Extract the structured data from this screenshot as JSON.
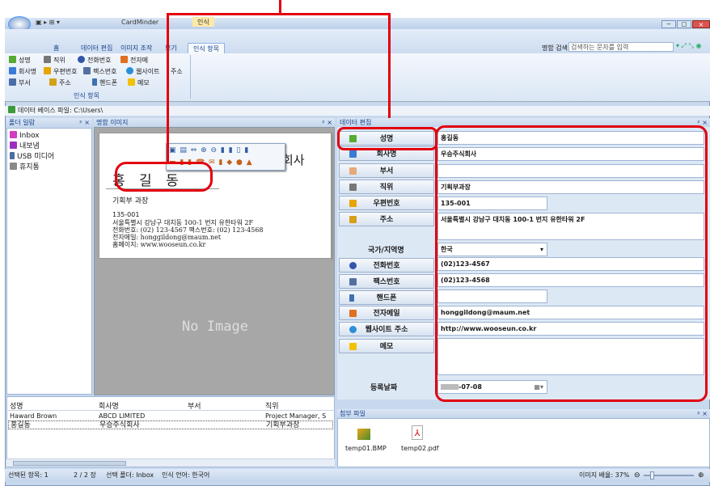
{
  "app": {
    "title": "CardMinder",
    "context_tab": "인식",
    "window_buttons": [
      "−",
      "□",
      "×"
    ]
  },
  "ribbon": {
    "tabs": [
      "홈",
      "데이터 편집",
      "이미지 조작",
      "보기",
      "인식 항목"
    ],
    "active_tab": "인식 항목",
    "search_label": "명함 검색:",
    "search_placeholder": "검색하는 문자를 입력",
    "items_row1": [
      "성명",
      "직위",
      "전화번호",
      "전자메"
    ],
    "items_row2": [
      "회사명",
      "우편번호",
      "팩스번호",
      "웹사이트",
      "주소"
    ],
    "items_row3": [
      "부서",
      "주소",
      "핸드폰",
      "메모"
    ],
    "group_label": "인식 항목"
  },
  "database_path": "데이터 베이스 파일: C:\\Users\\",
  "folder_panel": {
    "title": "폴더 일람",
    "items": [
      "Inbox",
      "내보냄",
      "USB 미디어",
      "휴지통"
    ]
  },
  "image_panel": {
    "title": "명함 이미지",
    "no_image": "No Image"
  },
  "card": {
    "company": "회사",
    "name": "홍 길 동",
    "dept_title": "기획부 과장",
    "postal": "135-001",
    "address": "서울특별시 강남구 대치동 100-1 번지 유한타워 2F",
    "phone_fax": "전화번호: (02) 123-4567   팩스번호: (02) 123-4568",
    "email": "전자메일: honggildong@maum.net",
    "web": "홈페이지: www.wooseun.co.kr"
  },
  "edit_panel": {
    "title": "데이터 편집",
    "fields": [
      {
        "label": "성명",
        "value": "홍길동"
      },
      {
        "label": "회사명",
        "value": "우승주식회사"
      },
      {
        "label": "부서",
        "value": ""
      },
      {
        "label": "직위",
        "value": "기획부과장"
      },
      {
        "label": "우편번호",
        "value": "135-001"
      },
      {
        "label": "주소",
        "value": "서울특별시 강남구 대치동 100-1 번지 유한타워 2F"
      }
    ],
    "country_label": "국가/지역명",
    "country_value": "한국",
    "fields2": [
      {
        "label": "전화번호",
        "value": "(02)123-4567"
      },
      {
        "label": "팩스번호",
        "value": "(02)123-4568"
      },
      {
        "label": "핸드폰",
        "value": ""
      },
      {
        "label": "전자메일",
        "value": "honggildong@maum.net"
      },
      {
        "label": "웹사이트 주소",
        "value": "http://www.wooseun.co.kr"
      },
      {
        "label": "메모",
        "value": ""
      }
    ],
    "reg_date_label": "등록날짜",
    "reg_date_value": "-07-08"
  },
  "card_list": {
    "headers": [
      "성명",
      "회사명",
      "부서",
      "직위"
    ],
    "rows": [
      [
        "Haward Brown",
        "ABCD LIMITED",
        "",
        "Project Manager, S"
      ],
      [
        "홍길동",
        "우승주식회사",
        "",
        "기획부과장"
      ]
    ]
  },
  "attachments": {
    "title": "첨부 파일",
    "files": [
      "temp01.BMP",
      "temp02.pdf"
    ]
  },
  "status": {
    "selected": "선택된 항목:  1",
    "page": "2 / 2 장",
    "folder": "선택 폴더: Inbox",
    "lang": "인식 언어: 한국어",
    "zoom": "이미지 배율: 37%"
  },
  "colors": {
    "highlight": "#e2000f",
    "accent": "#15428b"
  }
}
